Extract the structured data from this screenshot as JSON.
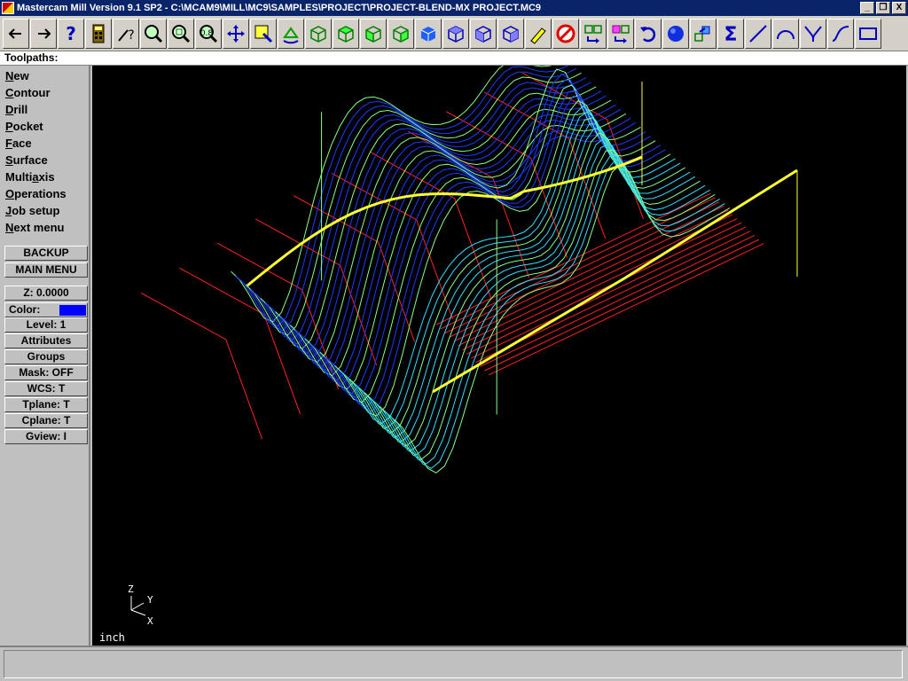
{
  "window": {
    "title": "Mastercam Mill Version 9.1 SP2 - C:\\MCAM9\\MILL\\MC9\\SAMPLES\\PROJECT\\PROJECT-BLEND-MX PROJECT.MC9",
    "controls": [
      "_",
      "❐",
      "X"
    ]
  },
  "toolbar": {
    "buttons": [
      "back-arrow-icon",
      "forward-arrow-icon",
      "help-icon",
      "calculator-icon",
      "analyze-icon",
      "zoom-window-icon",
      "fit-icon",
      "zoom-out-icon",
      "pan-icon",
      "select-icon",
      "rotate-icon",
      "cube-wire-icon",
      "cube-top-icon",
      "cube-front-icon",
      "cube-side-icon",
      "iso-cube-icon",
      "view-top-icon",
      "view-front-icon",
      "view-side-icon",
      "erase-icon",
      "no-icon",
      "xform-translate-icon",
      "xform-mirror-icon",
      "undo-icon",
      "shade-sphere-icon",
      "levels-icon",
      "sum-icon",
      "line-icon",
      "arc-icon",
      "fillet-icon",
      "spline-icon",
      "rectangle-icon"
    ]
  },
  "menu": {
    "header": "Toolpaths:",
    "items": [
      {
        "mn": "N",
        "rest": "ew",
        "pre": ""
      },
      {
        "mn": "C",
        "rest": "ontour",
        "pre": ""
      },
      {
        "mn": "D",
        "rest": "rill",
        "pre": ""
      },
      {
        "mn": "P",
        "rest": "ocket",
        "pre": ""
      },
      {
        "mn": "F",
        "rest": "ace",
        "pre": ""
      },
      {
        "mn": "S",
        "rest": "urface",
        "pre": ""
      },
      {
        "mn": "a",
        "rest": "xis",
        "pre": "Multi"
      },
      {
        "mn": "O",
        "rest": "perations",
        "pre": ""
      },
      {
        "mn": "J",
        "rest": "ob setup",
        "pre": ""
      },
      {
        "mn": "N",
        "rest": "ext menu",
        "pre": ""
      }
    ],
    "backup": "BACKUP",
    "main_menu": "MAIN MENU"
  },
  "settings": {
    "z": "Z:  0.0000",
    "color_label": "Color:",
    "color_value": "9",
    "level": "Level:  1",
    "attributes": "Attributes",
    "groups": "Groups",
    "mask": "Mask:  OFF",
    "wcs": "WCS:   T",
    "tplane": "Tplane:  T",
    "cplane": "Cplane:  T",
    "gview": "Gview:   I"
  },
  "viewport": {
    "units": "inch",
    "axes": {
      "z": "Z",
      "y": "Y",
      "x": "X"
    }
  },
  "status": {
    "prompt": ""
  },
  "colors": {
    "wire_red": "#ff2020",
    "toolpath_blue": "#1a3cff",
    "toolpath_cyan": "#30e0ff",
    "toolpath_green": "#8aff8a",
    "chain_yellow": "#ffff30",
    "background": "#000000"
  }
}
